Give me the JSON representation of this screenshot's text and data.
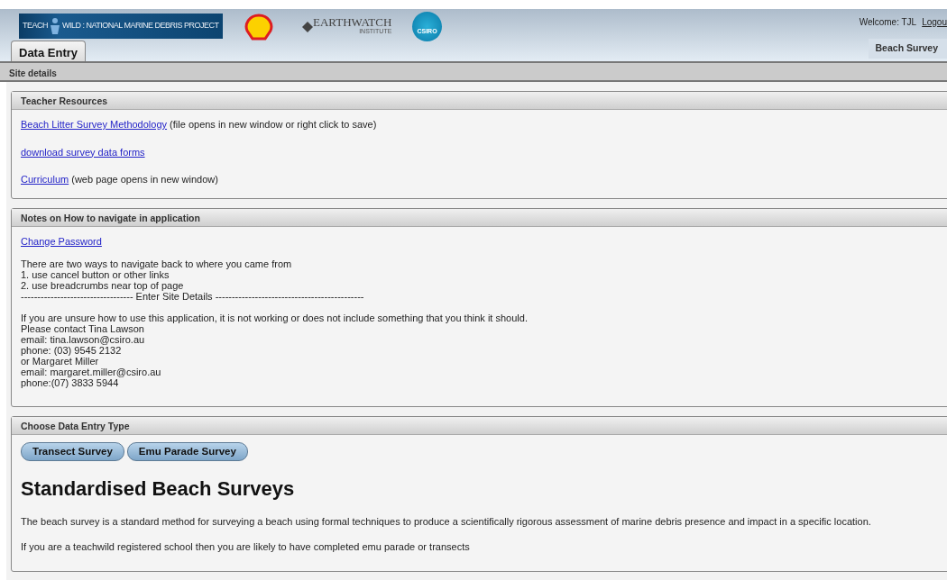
{
  "header": {
    "logo": {
      "left": "TEACH",
      "right": "WILD : NATIONAL MARINE DEBRIS PROJECT"
    },
    "sponsors": [
      {
        "kind": "shell"
      },
      {
        "kind": "earthwatch",
        "name": "EARTHWATCH",
        "sub": "INSTITUTE"
      },
      {
        "kind": "csiro",
        "name": "CSIRO"
      }
    ],
    "welcome": "Welcome: TJL",
    "logout": "Logou"
  },
  "tabs": [
    {
      "label": "Data Entry",
      "selected": true
    },
    {
      "label": "Beach Survey",
      "selected": false
    }
  ],
  "subnav": "Site details",
  "panels": [
    {
      "title": "Teacher Resources",
      "kind": "links",
      "items": [
        {
          "link": "Beach Litter Survey Methodology",
          "note": "(file opens in new window or right click to save)"
        },
        {
          "link": "download survey data forms"
        },
        {
          "link": "Curriculum",
          "note": "(web page opens in new window)"
        }
      ]
    },
    {
      "title": "Notes on How to navigate in application",
      "kind": "notes",
      "link": "Change Password",
      "blocks": [
        [
          "There are two ways to navigate back to where you came from",
          "1. use cancel button or other links",
          "2. use breadcrumbs near top of page",
          "---------------------------------- Enter Site Details ---------------------------------------------"
        ],
        [
          "If you are unsure how to use this application, it is not working or does not include something that you think it should.",
          "Please contact Tina Lawson",
          "email: tina.lawson@csiro.au",
          "phone: (03) 9545 2132",
          "or Margaret Miller",
          "email: margaret.miller@csiro.au",
          "phone:(07) 3833 5944"
        ]
      ]
    },
    {
      "title": "Choose Data Entry Type",
      "kind": "choose",
      "buttons": [
        "Transect Survey",
        "Emu Parade Survey"
      ],
      "heading": "Standardised Beach Surveys",
      "paragraphs": [
        "The beach survey is a standard method for surveying a beach using formal techniques to produce a scientifically rigorous assessment of marine debris presence and impact in a specific location.",
        "If you are a teachwild registered school then you are likely to have completed emu parade or transects"
      ]
    }
  ]
}
